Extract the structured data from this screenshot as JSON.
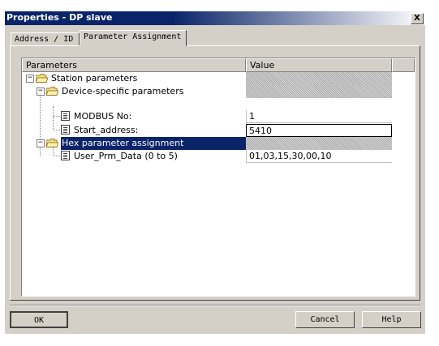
{
  "window": {
    "title": "Properties - DP slave",
    "close_label": "X"
  },
  "tabs": [
    {
      "label": "Address / ID",
      "active": false
    },
    {
      "label": "Parameter Assignment",
      "active": true
    }
  ],
  "grid": {
    "columns": {
      "parameters": "Parameters",
      "value": "Value"
    },
    "rows": [
      {
        "label": "Station parameters",
        "value": "",
        "expander": "−"
      },
      {
        "label": "Device-specific parameters",
        "value": "",
        "expander": "−"
      },
      {
        "label": "MODBUS No:",
        "value": "1"
      },
      {
        "label": "Start_address:",
        "value": "5410"
      },
      {
        "label": "Hex parameter assignment",
        "value": "",
        "expander": "−",
        "selected": true
      },
      {
        "label": "User_Prm_Data (0 to 5)",
        "value": "01,03,15,30,00,10"
      }
    ]
  },
  "buttons": {
    "ok": "OK",
    "cancel": "Cancel",
    "help": "Help"
  },
  "colors": {
    "titlebar": "#0a246a",
    "selection": "#0a246a",
    "dialog_face": "#d4d0c8"
  }
}
